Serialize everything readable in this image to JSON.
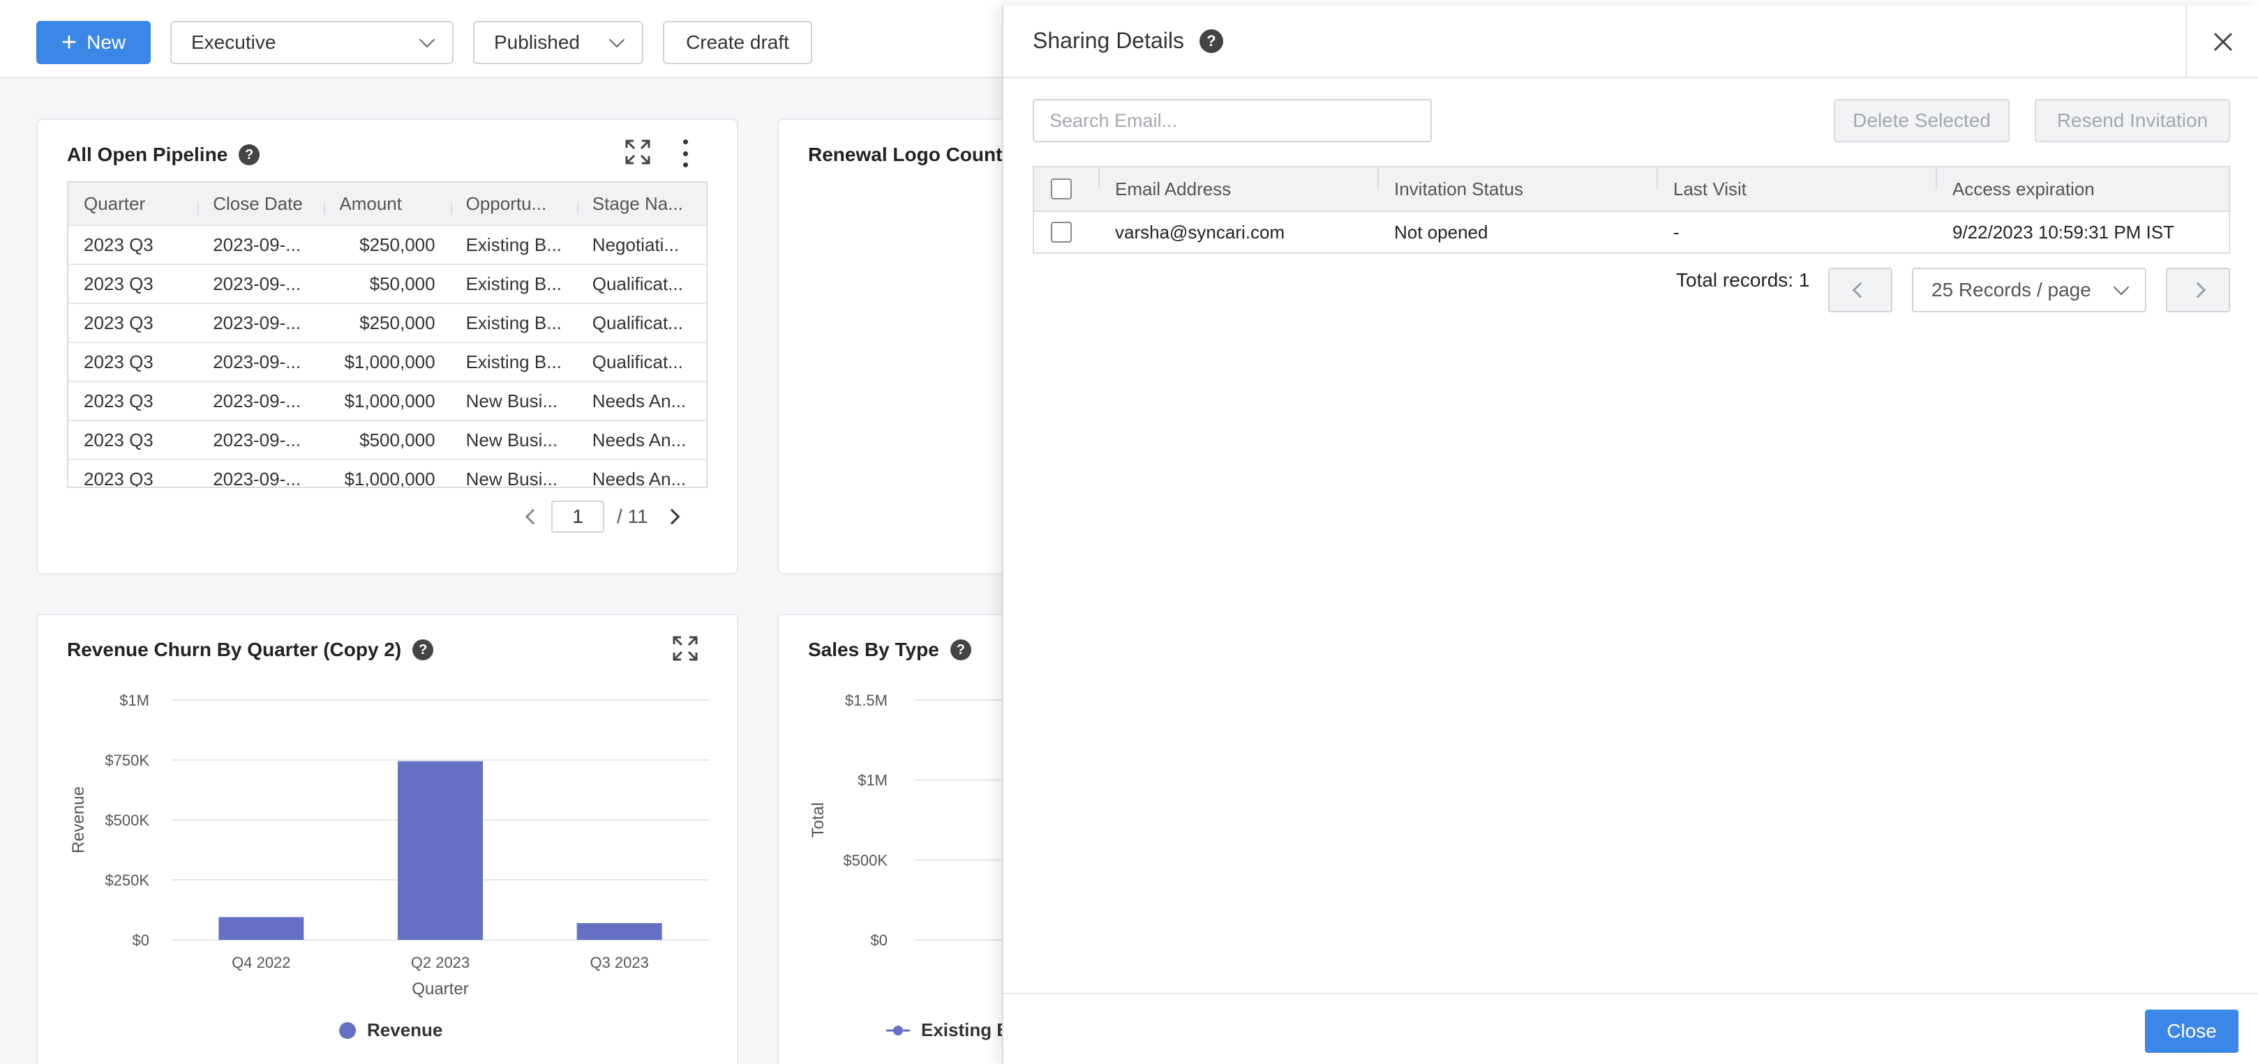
{
  "toolbar": {
    "new_label": "New",
    "dashboard_select": "Executive",
    "status_select": "Published",
    "create_draft_label": "Create draft"
  },
  "pipeline": {
    "title": "All Open Pipeline",
    "columns": [
      "Quarter",
      "Close Date",
      "Amount",
      "Opportu...",
      "Stage Na..."
    ],
    "rows": [
      [
        "2023 Q3",
        "2023-09-...",
        "$250,000",
        "Existing B...",
        "Negotiati..."
      ],
      [
        "2023 Q3",
        "2023-09-...",
        "$50,000",
        "Existing B...",
        "Qualificat..."
      ],
      [
        "2023 Q3",
        "2023-09-...",
        "$250,000",
        "Existing B...",
        "Qualificat..."
      ],
      [
        "2023 Q3",
        "2023-09-...",
        "$1,000,000",
        "Existing B...",
        "Qualificat..."
      ],
      [
        "2023 Q3",
        "2023-09-...",
        "$1,000,000",
        "New Busi...",
        "Needs An..."
      ],
      [
        "2023 Q3",
        "2023-09-...",
        "$500,000",
        "New Busi...",
        "Needs An..."
      ],
      [
        "2023 Q3",
        "2023-09-...",
        "$1,000,000",
        "New Busi...",
        "Needs An..."
      ]
    ],
    "page": "1",
    "total_pages": "/ 11"
  },
  "renewal": {
    "title": "Renewal Logo Count"
  },
  "churn": {
    "title": "Revenue Churn By Quarter (Copy 2)",
    "legend": "Revenue"
  },
  "sales": {
    "title": "Sales By Type",
    "legend": "Existing B"
  },
  "chart_data": [
    {
      "type": "bar",
      "title": "Revenue Churn By Quarter (Copy 2)",
      "categories": [
        "Q4 2022",
        "Q2 2023",
        "Q3 2023"
      ],
      "series": [
        {
          "name": "Revenue",
          "values": [
            95000,
            745000,
            70000
          ]
        }
      ],
      "xlabel": "Quarter",
      "ylabel": "Revenue",
      "ylim": [
        0,
        1000000
      ],
      "yticks": [
        "$0",
        "$250K",
        "$500K",
        "$750K",
        "$1M"
      ],
      "grid": true,
      "legend": "bottom",
      "color": "#6470c4"
    },
    {
      "type": "line",
      "title": "Sales By Type",
      "ylabel": "Total",
      "ylim": [
        0,
        1500000
      ],
      "yticks": [
        "$0",
        "$500K",
        "$1M",
        "$1.5M"
      ],
      "grid": true,
      "legend": "bottom",
      "series": [
        {
          "name": "Existing B"
        }
      ],
      "color": "#6470c4"
    }
  ],
  "sharing": {
    "title": "Sharing Details",
    "search_placeholder": "Search Email...",
    "delete_label": "Delete Selected",
    "resend_label": "Resend Invitation",
    "columns": [
      "Email Address",
      "Invitation Status",
      "Last Visit",
      "Access expiration"
    ],
    "rows": [
      [
        "varsha@syncari.com",
        "Not opened",
        "-",
        "9/22/2023 10:59:31 PM IST"
      ]
    ],
    "total_records": "Total records: 1",
    "records_per_page": "25 Records / page",
    "close_label": "Close"
  }
}
